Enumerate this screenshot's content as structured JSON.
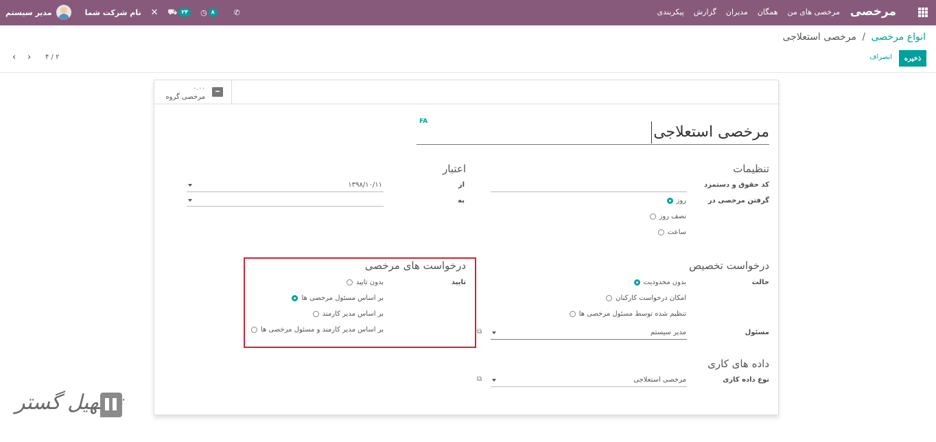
{
  "navbar": {
    "brand": "مرخصی",
    "menu": [
      "مرخصی های من",
      "همگان",
      "مدیران",
      "گزارش",
      "پیکربندی"
    ],
    "user_name": "مدیر سیستم",
    "company": "نام شرکت شما",
    "badge_activity": "۸",
    "badge_messages": "۲۴",
    "bg_color": "#875a7b"
  },
  "control_panel": {
    "breadcrumb_parent": "انواع مرخصی",
    "breadcrumb_separator": "/",
    "breadcrumb_current": "مرخصی استعلاجی",
    "save_label": "ذخیره",
    "discard_label": "انصراف",
    "pager_text": "۴ / ۲",
    "accent_color": "#00a09d"
  },
  "smart_button": {
    "value": "۰.۰۰",
    "label": "مرخصی گروه"
  },
  "form": {
    "lang_tag": "FA",
    "title": "مرخصی استعلاجی",
    "settings": {
      "header": "تنظیمات",
      "payroll_code_label": "کد حقوق و دستمزد",
      "payroll_code_value": "",
      "take_leave_in_label": "گرفتن مرخصی در",
      "take_leave_options": [
        "روز",
        "نصف روز",
        "ساعت"
      ],
      "take_leave_selected": 0
    },
    "validity": {
      "header": "اعتبار",
      "from_label": "از",
      "from_value": "۱۳۹۸/۱۰/۱۱",
      "to_label": "به",
      "to_value": ""
    },
    "allocation": {
      "header": "درخواست تخصیص",
      "mode_label": "حالت",
      "mode_options": [
        "بدون محدودیت",
        "امکان درخواست کارکنان",
        "تنظیم شده توسط مسئول مرخصی ها"
      ],
      "mode_selected": 0,
      "responsible_label": "مسئول",
      "responsible_value": "مدیر سیستم"
    },
    "leave_request": {
      "header": "درخواست های مرخصی",
      "validation_label": "تایید",
      "validation_options": [
        "بدون تایید",
        "بر اساس مسئول مرخصی ها",
        "بر اساس مدیر کارمند",
        "بر اساس مدیر کارمند و مسئول مرخصی ها"
      ],
      "validation_selected": 1
    },
    "work_entry": {
      "header": "داده های کاری",
      "type_label": "نوع داده کاری",
      "type_value": "مرخصی استعلاجی"
    }
  },
  "watermark": {
    "text": "تسهیل گستر"
  }
}
